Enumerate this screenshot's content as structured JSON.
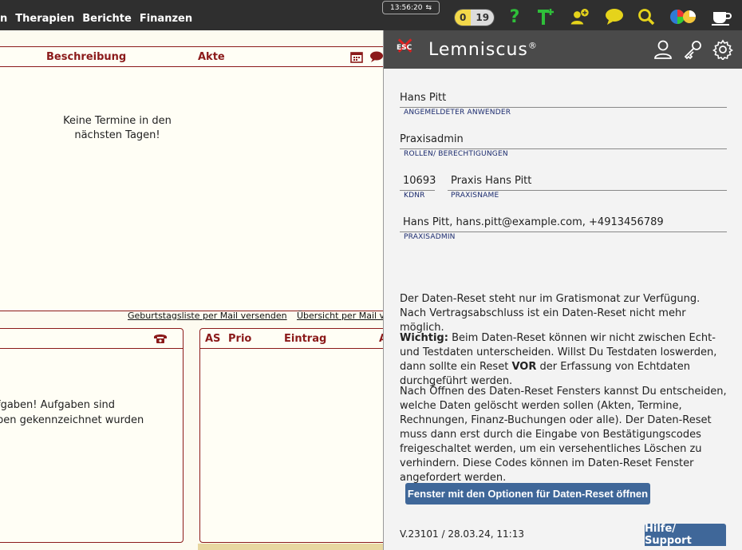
{
  "nav": {
    "items": [
      "n",
      "Therapien",
      "Berichte",
      "Finanzen"
    ]
  },
  "clock": {
    "time": "13:56:20",
    "symbol": "⇆"
  },
  "counter": {
    "a": "0",
    "b": "19"
  },
  "toolbar_icons": [
    "help-icon",
    "therapist-add-icon",
    "user-add-icon",
    "chat-icon",
    "search-icon",
    "color-wheel-icon",
    "coffee-icon"
  ],
  "appointments": {
    "col_description": "Beschreibung",
    "col_record": "Akte",
    "empty": "Keine Termine in den nächsten Tagen!",
    "link_birthday": "Geburtstagsliste per Mail versenden",
    "link_overview": "Übersicht per Mail ver"
  },
  "tasks": {
    "text_line1": "fgaben! Aufgaben sind",
    "text_line2": "ben gekennzeichnet wurden"
  },
  "entries": {
    "col_as": "AS",
    "col_prio": "Prio",
    "col_entry": "Eintrag",
    "col_extra": "A"
  },
  "panel": {
    "esc": "ESC",
    "brand": "Lemniscus",
    "brand_mark": "®",
    "user_value": "Hans Pitt",
    "user_label": "ANGEMELDETER ANWENDER",
    "role_value": "Praxisadmin",
    "role_label": "ROLLEN/ BERECHTIGUNGEN",
    "kdnr_value": "10693",
    "kdnr_label": "KDNR",
    "praxis_value": "Praxis Hans Pitt",
    "praxis_label": "PRAXISNAME",
    "admin_value": "Hans Pitt, hans.pitt@example.com, +4913456789",
    "admin_label": "PRAXISADMIN",
    "info1": "Der Daten-Reset steht nur im Gratismonat zur Verfügung. Nach Vertragsabschluss ist ein Daten-Reset nicht mehr möglich.",
    "info2_bold": "Wichtig:",
    "info2_a": " Beim Daten-Reset können wir nicht zwischen Echt- und Testdaten unterscheiden. Willst Du Testdaten loswerden, dann sollte ein Reset ",
    "info2_bold2": "VOR",
    "info2_b": " der Erfassung von Echtdaten durchgeführt werden.",
    "info3": "Nach Öffnen des Daten-Reset Fensters kannst Du entscheiden, welche Daten gelöscht werden sollen (Akten, Termine, Rechnungen, Finanz-Buchungen oder alle). Der Daten-Reset muss dann erst durch die Eingabe von Bestätigungscodes freigeschaltet werden, um ein versehentliches Löschen zu verhindern. Diese Codes können im Daten-Reset Fenster angefordert werden.",
    "reset_button": "Fenster mit den Optionen für Daten-Reset öffnen",
    "version": "V.23101 / 28.03.24, 11:13",
    "help_button": "Hilfe/ Support"
  }
}
